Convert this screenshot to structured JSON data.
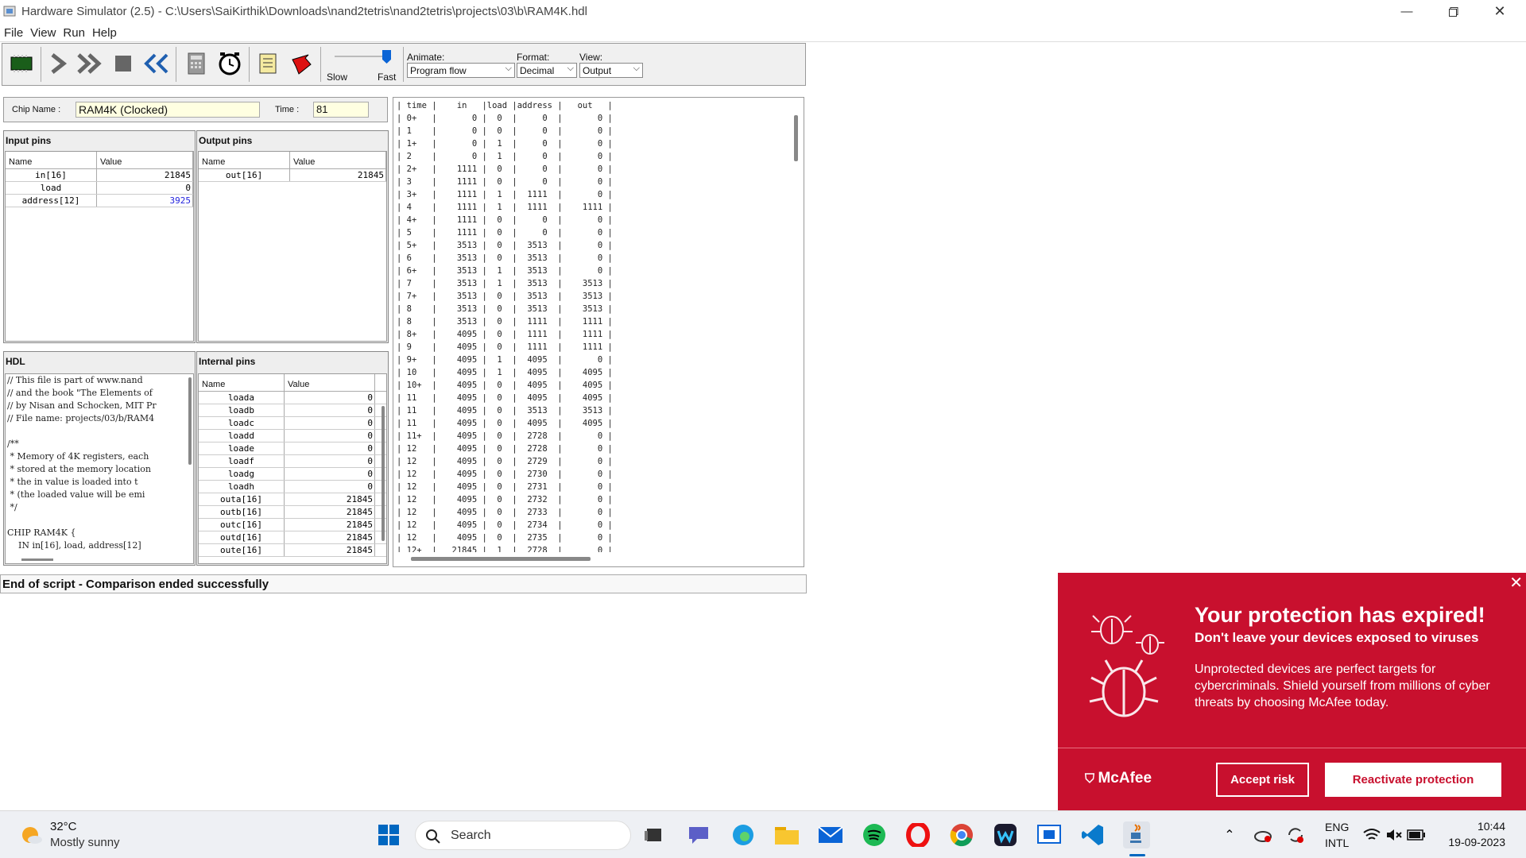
{
  "window": {
    "title": "Hardware Simulator (2.5) - C:\\Users\\SaiKirthik\\Downloads\\nand2tetris\\nand2tetris\\projects\\03\\b\\RAM4K.hdl"
  },
  "menu": [
    "File",
    "View",
    "Run",
    "Help"
  ],
  "toolbar": {
    "slow": "Slow",
    "fast": "Fast",
    "animate_label": "Animate:",
    "animate_value": "Program flow",
    "format_label": "Format:",
    "format_value": "Decimal",
    "view_label": "View:",
    "view_value": "Output"
  },
  "chip": {
    "name_label": "Chip Name :",
    "name_value": "RAM4K (Clocked)",
    "time_label": "Time :",
    "time_value": "81"
  },
  "input_pins": {
    "title": "Input pins",
    "col_name": "Name",
    "col_value": "Value",
    "rows": [
      [
        "in[16]",
        "21845"
      ],
      [
        "load",
        "0"
      ],
      [
        "address[12]",
        "3925"
      ]
    ]
  },
  "output_pins": {
    "title": "Output pins",
    "col_name": "Name",
    "col_value": "Value",
    "rows": [
      [
        "out[16]",
        "21845"
      ]
    ]
  },
  "internal_pins": {
    "title": "Internal pins",
    "col_name": "Name",
    "col_value": "Value",
    "rows": [
      [
        "loada",
        "0"
      ],
      [
        "loadb",
        "0"
      ],
      [
        "loadc",
        "0"
      ],
      [
        "loadd",
        "0"
      ],
      [
        "loade",
        "0"
      ],
      [
        "loadf",
        "0"
      ],
      [
        "loadg",
        "0"
      ],
      [
        "loadh",
        "0"
      ],
      [
        "outa[16]",
        "21845"
      ],
      [
        "outb[16]",
        "21845"
      ],
      [
        "outc[16]",
        "21845"
      ],
      [
        "outd[16]",
        "21845"
      ],
      [
        "oute[16]",
        "21845"
      ]
    ]
  },
  "hdl": {
    "title": "HDL",
    "text": "// This file is part of www.nand\n// and the book \"The Elements of\n// by Nisan and Schocken, MIT Pr\n// File name: projects/03/b/RAM4\n\n/**\n * Memory of 4K registers, each\n * stored at the memory location\n * the in value is loaded into t\n * (the loaded value will be emi\n */\n\nCHIP RAM4K {\n    IN in[16], load, address[12]"
  },
  "output_script": {
    "text": "| time |    in   |load |address |   out   |\n| 0+   |       0 |  0  |     0  |       0 |\n| 1    |       0 |  0  |     0  |       0 |\n| 1+   |       0 |  1  |     0  |       0 |\n| 2    |       0 |  1  |     0  |       0 |\n| 2+   |    1111 |  0  |     0  |       0 |\n| 3    |    1111 |  0  |     0  |       0 |\n| 3+   |    1111 |  1  |  1111  |       0 |\n| 4    |    1111 |  1  |  1111  |    1111 |\n| 4+   |    1111 |  0  |     0  |       0 |\n| 5    |    1111 |  0  |     0  |       0 |\n| 5+   |    3513 |  0  |  3513  |       0 |\n| 6    |    3513 |  0  |  3513  |       0 |\n| 6+   |    3513 |  1  |  3513  |       0 |\n| 7    |    3513 |  1  |  3513  |    3513 |\n| 7+   |    3513 |  0  |  3513  |    3513 |\n| 8    |    3513 |  0  |  3513  |    3513 |\n| 8    |    3513 |  0  |  1111  |    1111 |\n| 8+   |    4095 |  0  |  1111  |    1111 |\n| 9    |    4095 |  0  |  1111  |    1111 |\n| 9+   |    4095 |  1  |  4095  |       0 |\n| 10   |    4095 |  1  |  4095  |    4095 |\n| 10+  |    4095 |  0  |  4095  |    4095 |\n| 11   |    4095 |  0  |  4095  |    4095 |\n| 11   |    4095 |  0  |  3513  |    3513 |\n| 11   |    4095 |  0  |  4095  |    4095 |\n| 11+  |    4095 |  0  |  2728  |       0 |\n| 12   |    4095 |  0  |  2728  |       0 |\n| 12   |    4095 |  0  |  2729  |       0 |\n| 12   |    4095 |  0  |  2730  |       0 |\n| 12   |    4095 |  0  |  2731  |       0 |\n| 12   |    4095 |  0  |  2732  |       0 |\n| 12   |    4095 |  0  |  2733  |       0 |\n| 12   |    4095 |  0  |  2734  |       0 |\n| 12   |    4095 |  0  |  2735  |       0 |\n| 12+  |   21845 |  1  |  2728  |       0 |"
  },
  "status": "End of script - Comparison ended successfully",
  "mcafee": {
    "heading": "Your protection has expired!",
    "subheading": "Don't leave your devices exposed to viruses",
    "body": "Unprotected devices are perfect targets for cybercriminals. Shield yourself from millions of cyber threats by choosing McAfee today.",
    "brand": "McAfee",
    "accept": "Accept risk",
    "reactivate": "Reactivate protection"
  },
  "taskbar": {
    "weather_temp": "32°C",
    "weather_desc": "Mostly sunny",
    "search": "Search",
    "lang1": "ENG",
    "lang2": "INTL",
    "time": "10:44",
    "date": "19-09-2023"
  },
  "colors": {
    "mcafee_red": "#c8102e",
    "accent_blue": "#0067c0"
  }
}
